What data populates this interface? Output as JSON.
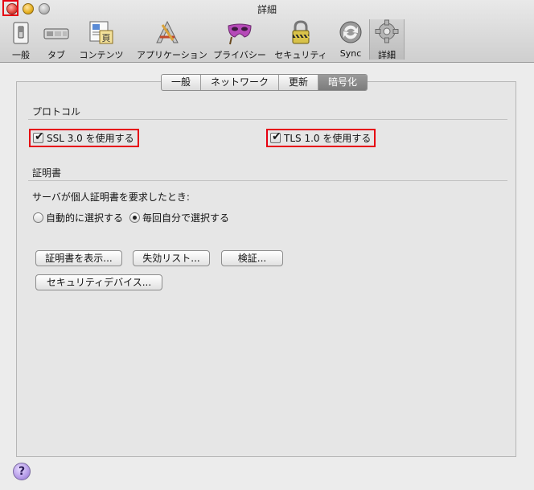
{
  "window": {
    "title": "詳細"
  },
  "toolbar": {
    "items": [
      {
        "label": "一般",
        "icon": "light-switch-icon"
      },
      {
        "label": "タブ",
        "icon": "tabs-icon"
      },
      {
        "label": "コンテンツ",
        "icon": "content-icon"
      },
      {
        "label": "アプリケーション",
        "icon": "applications-icon"
      },
      {
        "label": "プライバシー",
        "icon": "privacy-mask-icon"
      },
      {
        "label": "セキュリティ",
        "icon": "lock-icon"
      },
      {
        "label": "Sync",
        "icon": "sync-icon"
      },
      {
        "label": "詳細",
        "icon": "gear-icon"
      }
    ],
    "active": "詳細"
  },
  "tabs": {
    "items": [
      "一般",
      "ネットワーク",
      "更新",
      "暗号化"
    ],
    "selected": "暗号化"
  },
  "protocol": {
    "title": "プロトコル",
    "ssl_label": "SSL 3.0 を使用する",
    "tls_label": "TLS 1.0 を使用する",
    "ssl_checked": true,
    "tls_checked": true
  },
  "certificates": {
    "title": "証明書",
    "prompt": "サーバが個人証明書を要求したとき:",
    "radio_auto": "自動的に選択する",
    "radio_ask": "毎回自分で選択する",
    "selected": "毎回自分で選択する",
    "btn_show": "証明書を表示...",
    "btn_revocation": "失効リスト...",
    "btn_validate": "検証...",
    "btn_devices": "セキュリティデバイス..."
  },
  "help": {
    "label": "?"
  },
  "colors": {
    "highlight": "#e60012"
  }
}
